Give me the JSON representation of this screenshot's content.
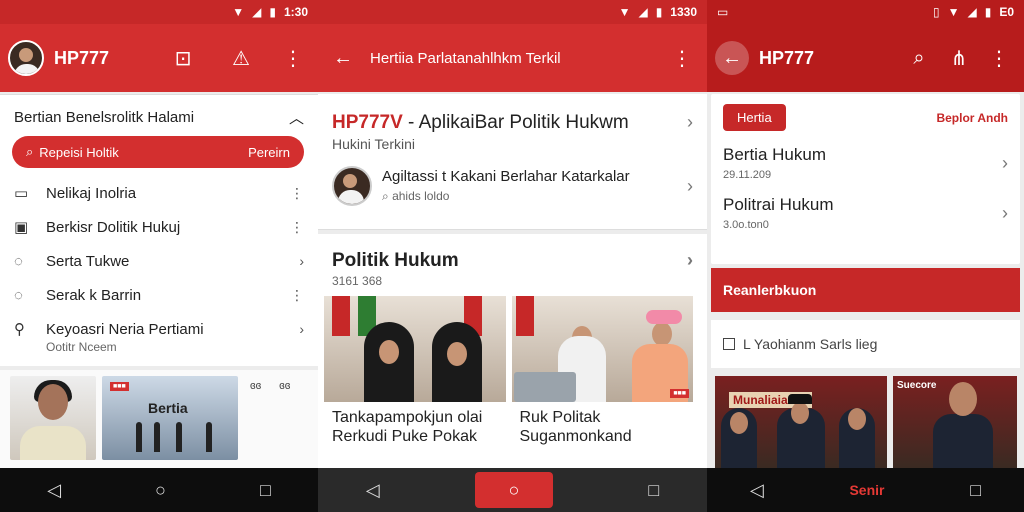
{
  "screen1": {
    "statusbar": {
      "time": "1:30"
    },
    "appbar": {
      "title": "HP777"
    },
    "section": {
      "title": "Bertian Benelsrolitk Halami"
    },
    "search": {
      "label": "Repeisi Holtik",
      "trailing": "Pereirn"
    },
    "menu": [
      {
        "icon": "inbox-icon",
        "label": "Nelikaj Inolria",
        "trail": "⋮"
      },
      {
        "icon": "square-icon",
        "label": "Berkisr Dolitik Hukuj",
        "trail": "⋮"
      },
      {
        "icon": "location-icon",
        "label": "Serta Tukwe",
        "trail": "›"
      },
      {
        "icon": "location-icon",
        "label": "Serak k Barrin",
        "trail": "⋮"
      },
      {
        "icon": "person-icon",
        "label": "Keyoasri Neria Pertiami",
        "trail": "›"
      }
    ],
    "menu_sub": "Ootitr Nceem",
    "thumb": {
      "badge": "■■■",
      "art_text": "Bertia",
      "meta1": "ɞɞ",
      "meta2": "ɞɞ"
    }
  },
  "screen2": {
    "statusbar": {
      "time": "1330"
    },
    "appbar": {
      "title": "Hertiia Parlatanahlhkm Terkil"
    },
    "card1": {
      "headline_brand": "HP777V",
      "headline_rest": " - AplikaiBar Politik Hukwm",
      "subtitle": "Hukini Terkini",
      "item_title": "Agiltassi t Kakani Berlahar Katarkalar",
      "item_meta": "ahids loldo"
    },
    "card2": {
      "title": "Politik Hukum",
      "date": "3161 368",
      "caption1": "Tankapampokjun olai Rerkudi Puke Pokak",
      "caption2": "Ruk Politak Suganmonkand",
      "photo2_badge": "■■■"
    }
  },
  "screen3": {
    "statusbar": {
      "time": "E0"
    },
    "appbar": {
      "title": "HP777"
    },
    "chip": "Hertia",
    "link": "Beplor Andh",
    "items": [
      {
        "title": "Bertia Hukum",
        "date": "29.11.209"
      },
      {
        "title": "Politrai Hukum",
        "date": "3.0o.ton0"
      }
    ],
    "banner": "Reanlerbkuon",
    "checkbox_label": "L Yaohianm Sarls lieg",
    "photo1_sign": "Munaliaianaa",
    "photo2_label": "Suecore",
    "nav_label": "Senir"
  }
}
